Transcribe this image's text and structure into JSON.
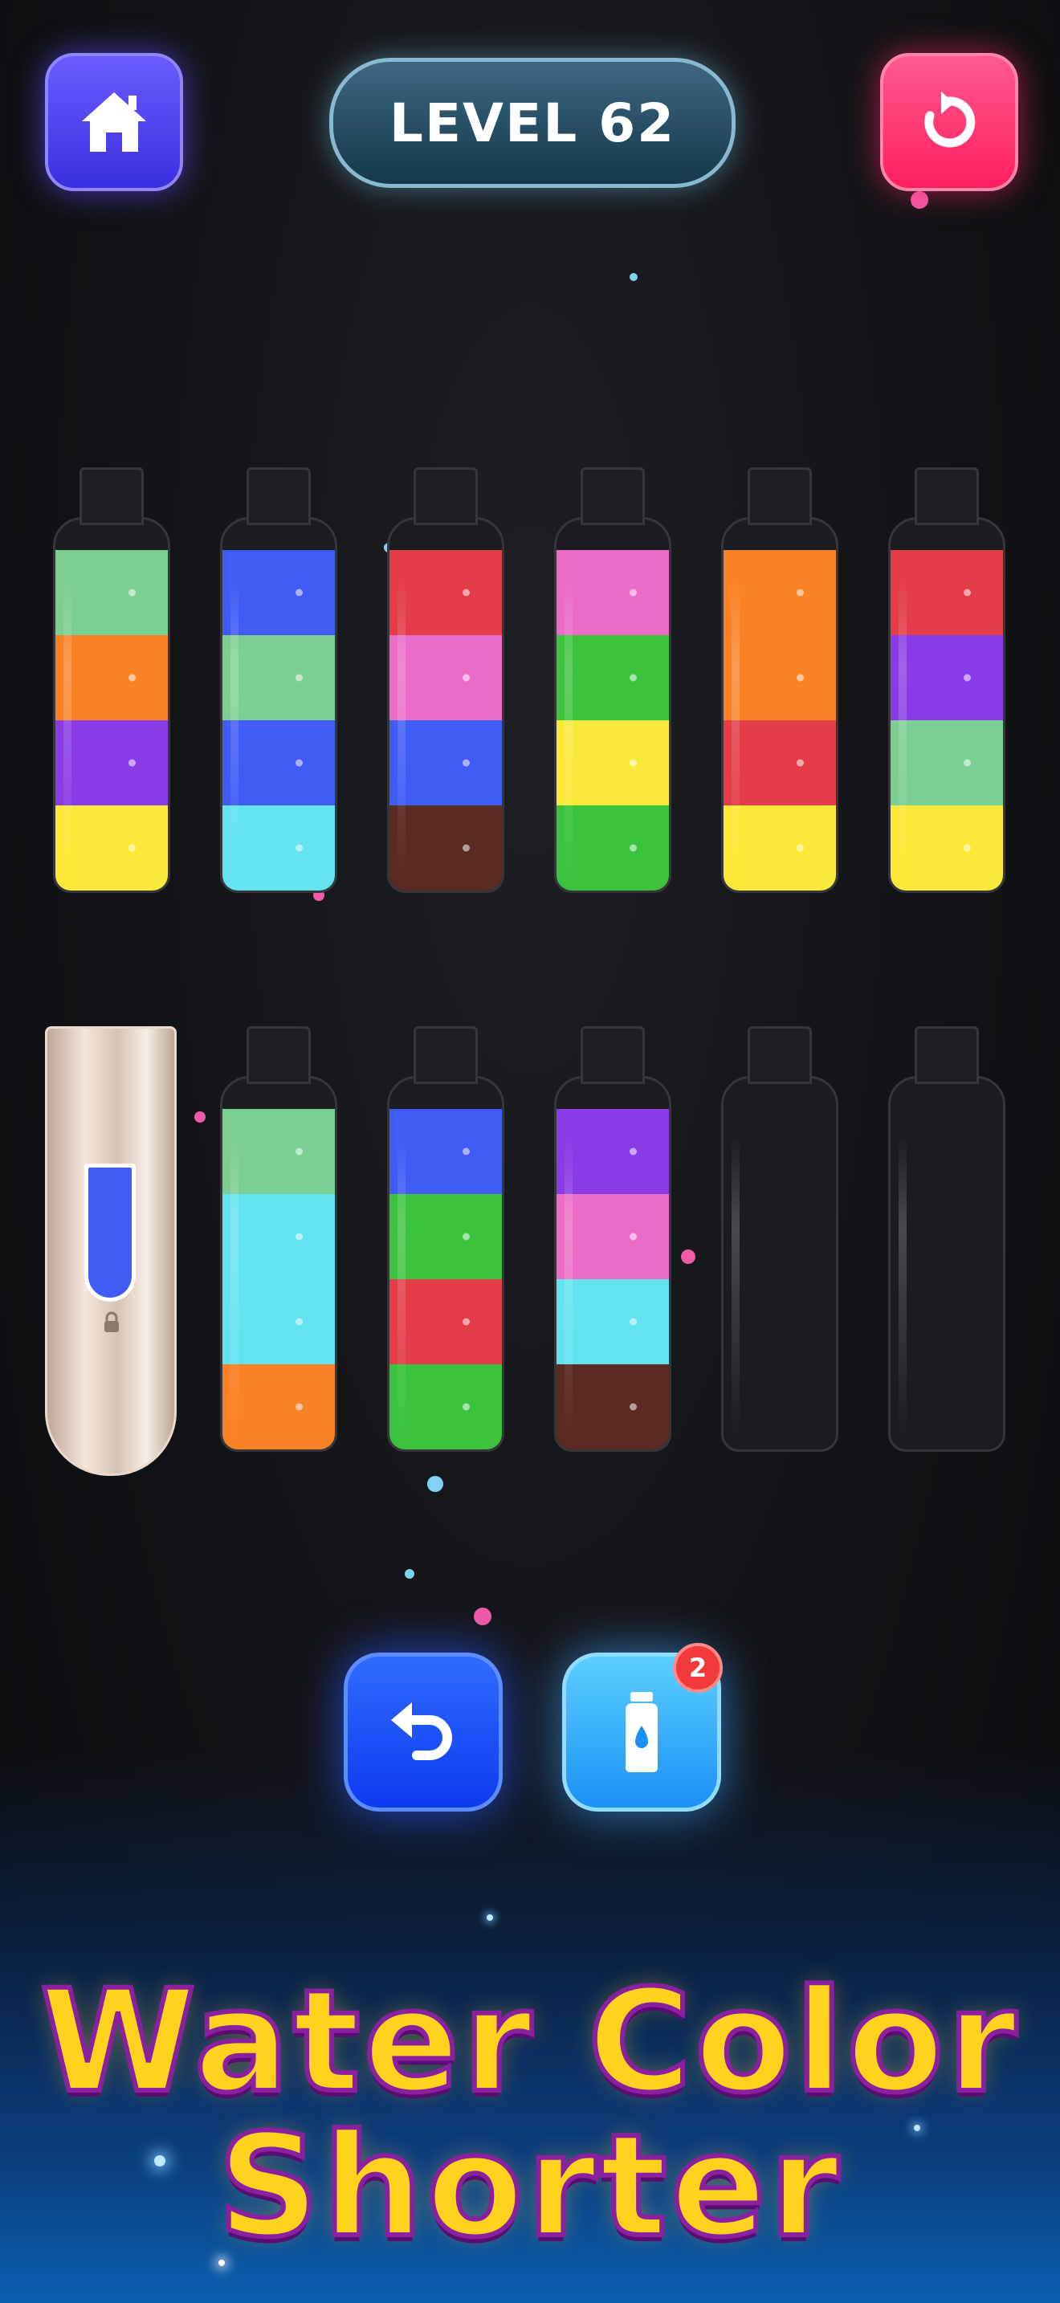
{
  "header": {
    "level_label": "LEVEL 62"
  },
  "colors": {
    "green_light": "#7ccf93",
    "orange": "#fa8226",
    "purple": "#8a3be6",
    "yellow": "#fbe93a",
    "blue": "#3f5cf5",
    "cyan": "#62e3ef",
    "red": "#e43d48",
    "pink": "#ea6cc6",
    "brown": "#5b2a22",
    "green": "#3cc33e"
  },
  "bottles_row1": [
    {
      "id": 1,
      "layers_top_to_bottom": [
        "green_light",
        "orange",
        "purple",
        "yellow"
      ]
    },
    {
      "id": 2,
      "layers_top_to_bottom": [
        "blue",
        "green_light",
        "blue",
        "cyan"
      ]
    },
    {
      "id": 3,
      "layers_top_to_bottom": [
        "red",
        "pink",
        "blue",
        "brown"
      ]
    },
    {
      "id": 4,
      "layers_top_to_bottom": [
        "pink",
        "green",
        "yellow",
        "green"
      ]
    },
    {
      "id": 5,
      "layers_top_to_bottom": [
        "orange",
        "orange",
        "red",
        "yellow"
      ]
    },
    {
      "id": 6,
      "layers_top_to_bottom": [
        "red",
        "purple",
        "green_light",
        "yellow"
      ]
    }
  ],
  "bottles_row2": [
    {
      "id": 7,
      "locked": true,
      "preview_color": "blue"
    },
    {
      "id": 8,
      "layers_top_to_bottom": [
        "green_light",
        "cyan",
        "cyan",
        "orange"
      ]
    },
    {
      "id": 9,
      "layers_top_to_bottom": [
        "blue",
        "green",
        "red",
        "green"
      ]
    },
    {
      "id": 10,
      "layers_top_to_bottom": [
        "purple",
        "pink",
        "cyan",
        "brown"
      ]
    },
    {
      "id": 11,
      "layers_top_to_bottom": []
    },
    {
      "id": 12,
      "layers_top_to_bottom": []
    }
  ],
  "actions": {
    "undo_icon": "undo-arrow-icon",
    "add_bottle_icon": "water-bottle-icon",
    "add_bottle_count": "2"
  },
  "title": {
    "line1": "Water Color",
    "line2": "Shorter"
  }
}
